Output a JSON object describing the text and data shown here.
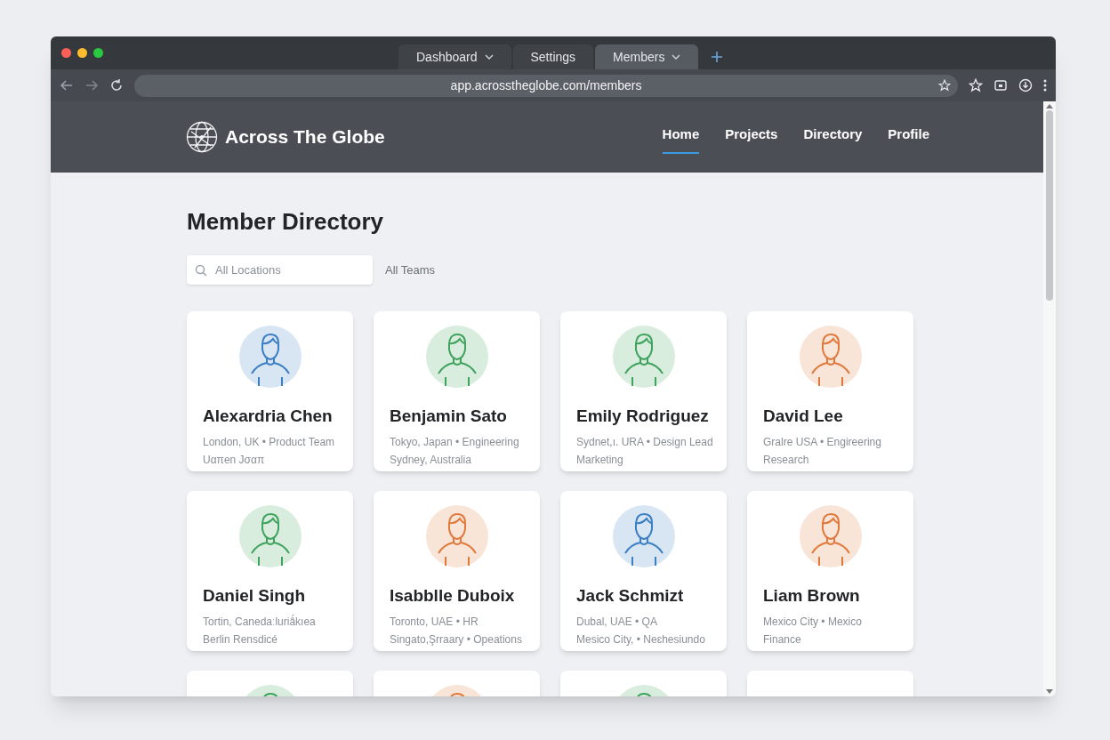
{
  "browser": {
    "tabs": [
      {
        "label": "Dashboard",
        "selected": false,
        "dropdown": true
      },
      {
        "label": "Settings",
        "selected": false,
        "dropdown": false
      },
      {
        "label": "Members",
        "selected": true,
        "dropdown": true
      }
    ],
    "url": "app.acrosstheglobe.com/members"
  },
  "site": {
    "brand": "Across The Globe",
    "nav": [
      {
        "label": "Home",
        "selected": true
      },
      {
        "label": "Projects",
        "selected": false
      },
      {
        "label": "Directory",
        "selected": false
      },
      {
        "label": "Profile",
        "selected": false
      }
    ]
  },
  "page": {
    "title": "Member Directory",
    "search": {
      "placeholder": "All Locations"
    },
    "team_filter": "All Teams"
  },
  "members": [
    {
      "name": "Alexardria Chen",
      "line1": "London, UK • Product Team",
      "line2": "Uαπen Jσαπ",
      "color": "#3b7fc4"
    },
    {
      "name": "Benjamin Sato",
      "line1": "Tokyo, Japan • Engineering",
      "line2": "Sydney, Australia",
      "color": "#3fa35e"
    },
    {
      "name": "Emily Rodriguez",
      "line1": "Sydnet,ı. URA • Design Lead",
      "line2": "Marketing",
      "color": "#3fa35e"
    },
    {
      "name": "David Lee",
      "line1": "Gralre USA • Engireering",
      "line2": "Research",
      "color": "#e07a3c"
    },
    {
      "name": "Daniel Singh",
      "line1": "Tortin, Canedaːluriǻkıea",
      "line2": "Berlin Rensdicé",
      "color": "#3fa35e"
    },
    {
      "name": "Isabblle Duboix",
      "line1": "Toronto, UAE • HR",
      "line2": "Singato,Şrraary • Opeations",
      "color": "#e07a3c"
    },
    {
      "name": "Jack Schmizt",
      "line1": "Dubal, UAE • QA",
      "line2": "Mesico City, • Neɛhesiundo",
      "color": "#3b7fc4"
    },
    {
      "name": "Liam Brown",
      "line1": "Mexico City • Mexico",
      "line2": "Finance",
      "color": "#e07a3c"
    }
  ],
  "more_cards": [
    {
      "avatar": true,
      "color": "#3fa35e"
    },
    {
      "avatar": true,
      "color": "#e07a3c"
    },
    {
      "avatar": true,
      "color": "#3fa35e"
    },
    {
      "avatar": false
    }
  ]
}
